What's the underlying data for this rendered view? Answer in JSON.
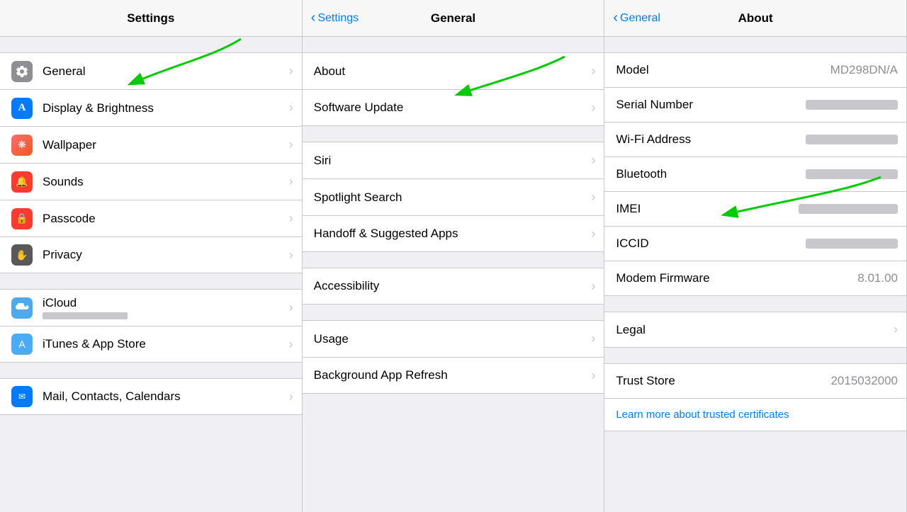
{
  "col1": {
    "title": "Settings",
    "items_group1": [
      {
        "id": "general",
        "label": "General",
        "icon_class": "icon-general",
        "icon_char": "⚙"
      },
      {
        "id": "display",
        "label": "Display & Brightness",
        "icon_class": "icon-display",
        "icon_char": "A"
      },
      {
        "id": "wallpaper",
        "label": "Wallpaper",
        "icon_class": "icon-wallpaper",
        "icon_char": "✦"
      },
      {
        "id": "sounds",
        "label": "Sounds",
        "icon_class": "icon-sounds",
        "icon_char": "🔔"
      },
      {
        "id": "passcode",
        "label": "Passcode",
        "icon_class": "icon-passcode",
        "icon_char": "🔒"
      },
      {
        "id": "privacy",
        "label": "Privacy",
        "icon_class": "icon-privacy",
        "icon_char": "✋"
      }
    ],
    "items_group2": [
      {
        "id": "icloud",
        "label": "iCloud",
        "sublabel": "████████ ████",
        "icon_class": "icon-icloud",
        "icon_char": "☁"
      },
      {
        "id": "itunes",
        "label": "iTunes & App Store",
        "icon_class": "icon-itunes",
        "icon_char": "A"
      }
    ],
    "items_group3": [
      {
        "id": "mail",
        "label": "Mail, Contacts, Calendars",
        "icon_class": "icon-mail",
        "icon_char": "✉"
      }
    ]
  },
  "col2": {
    "back_label": "Settings",
    "title": "General",
    "group1": [
      {
        "id": "about",
        "label": "About"
      },
      {
        "id": "software_update",
        "label": "Software Update"
      }
    ],
    "group2": [
      {
        "id": "siri",
        "label": "Siri"
      },
      {
        "id": "spotlight",
        "label": "Spotlight Search"
      },
      {
        "id": "handoff",
        "label": "Handoff & Suggested Apps"
      }
    ],
    "group3": [
      {
        "id": "accessibility",
        "label": "Accessibility"
      }
    ],
    "group4": [
      {
        "id": "usage",
        "label": "Usage"
      },
      {
        "id": "background_refresh",
        "label": "Background App Refresh"
      }
    ]
  },
  "col3": {
    "back_label": "General",
    "title": "About",
    "group1": [
      {
        "id": "model",
        "label": "Model",
        "value": "MD298DN/A",
        "blurred": false,
        "chevron": false
      },
      {
        "id": "serial",
        "label": "Serial Number",
        "value": "████████████████",
        "blurred": true,
        "chevron": false
      },
      {
        "id": "wifi",
        "label": "Wi-Fi Address",
        "value": "████████████████",
        "blurred": true,
        "chevron": false
      },
      {
        "id": "bluetooth",
        "label": "Bluetooth",
        "value": "████████████████",
        "blurred": true,
        "chevron": false
      },
      {
        "id": "imei",
        "label": "IMEI",
        "value": "██ ███████ ██████ █",
        "blurred": true,
        "chevron": false
      },
      {
        "id": "iccid",
        "label": "ICCID",
        "value": "████████████████",
        "blurred": true,
        "chevron": false
      },
      {
        "id": "modem",
        "label": "Modem Firmware",
        "value": "8.01.00",
        "blurred": false,
        "chevron": false
      }
    ],
    "group2": [
      {
        "id": "legal",
        "label": "Legal",
        "value": "",
        "blurred": false,
        "chevron": true
      }
    ],
    "group3": [
      {
        "id": "trust_store",
        "label": "Trust Store",
        "value": "2015032000",
        "blurred": false,
        "chevron": false
      },
      {
        "id": "learn_more",
        "label": "Learn more about trusted certificates",
        "value": "",
        "blurred": false,
        "chevron": false,
        "link": true
      }
    ]
  }
}
